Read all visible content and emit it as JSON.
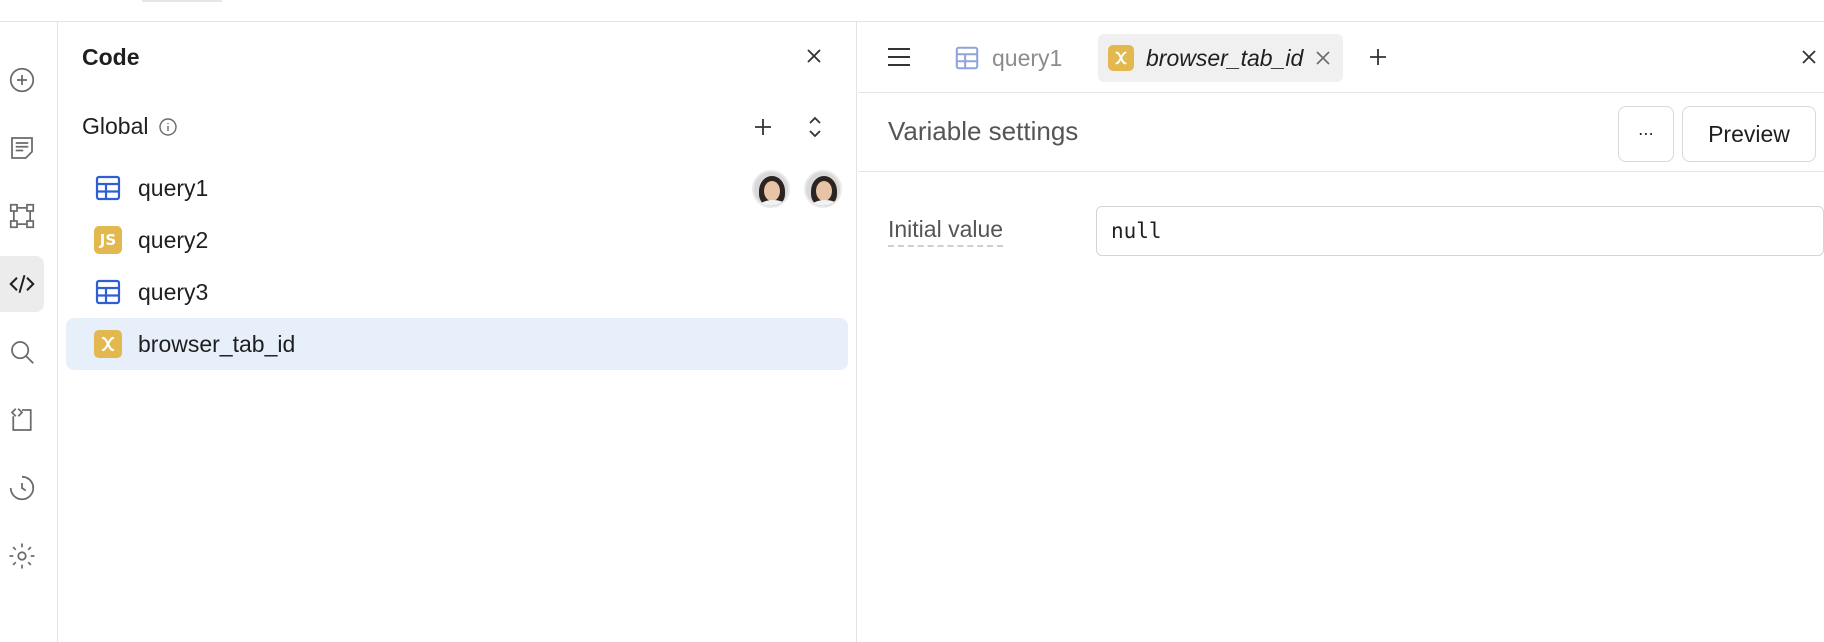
{
  "code_panel": {
    "title": "Code",
    "group_label": "Global",
    "items": [
      {
        "label": "query1",
        "icon": "table-icon",
        "show_avatars": true
      },
      {
        "label": "query2",
        "icon": "js-icon",
        "badge": "JS"
      },
      {
        "label": "query3",
        "icon": "table-icon"
      },
      {
        "label": "browser_tab_id",
        "icon": "variable-icon",
        "selected": true
      }
    ]
  },
  "editor": {
    "tabs": [
      {
        "label": "query1",
        "icon": "table-icon",
        "active": false
      },
      {
        "label": "browser_tab_id",
        "icon": "variable-icon",
        "active": true
      }
    ],
    "settings_title": "Variable settings",
    "more_label": "⋯",
    "preview_label": "Preview",
    "initial_value_label": "Initial value",
    "initial_value": "null"
  },
  "colors": {
    "accent_blue": "#2f5fd0",
    "badge_yellow": "#e2b84f",
    "selected_bg": "#e6effa"
  }
}
